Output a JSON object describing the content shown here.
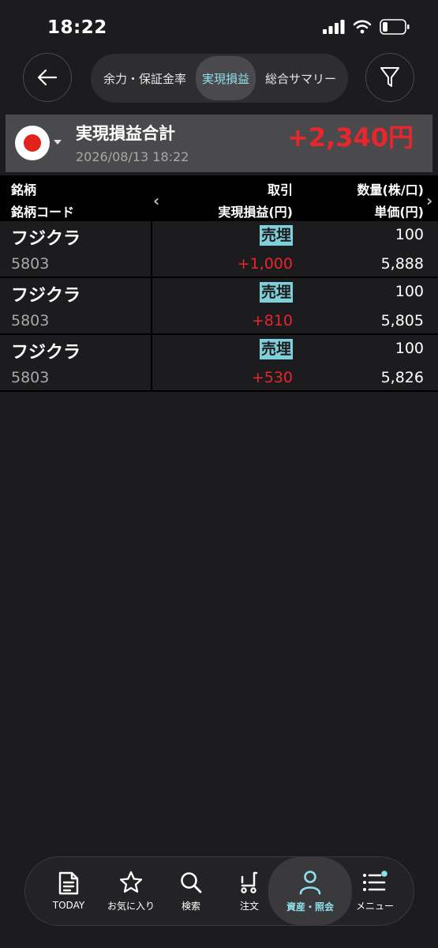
{
  "status": {
    "time": "18:22"
  },
  "tabs": [
    {
      "label": "余力・保証金率"
    },
    {
      "label": "実現損益"
    },
    {
      "label": "総合サマリー"
    }
  ],
  "summary": {
    "title": "実現損益合計",
    "date": "2026/08/13 18:22",
    "total": "+2,340円"
  },
  "table": {
    "headers": {
      "name": "銘柄",
      "code": "銘柄コード",
      "trade": "取引",
      "pl": "実現損益(円)",
      "qty": "数量(株/口)",
      "price": "単価(円)"
    },
    "rows": [
      {
        "name": "フジクラ",
        "code": "5803",
        "side": "売埋",
        "pl": "+1,000",
        "qty": "100",
        "price": "5,888"
      },
      {
        "name": "フジクラ",
        "code": "5803",
        "side": "売埋",
        "pl": "+810",
        "qty": "100",
        "price": "5,805"
      },
      {
        "name": "フジクラ",
        "code": "5803",
        "side": "売埋",
        "pl": "+530",
        "qty": "100",
        "price": "5,826"
      }
    ]
  },
  "nav": [
    {
      "label": "TODAY",
      "icon": "document-icon"
    },
    {
      "label": "お気に入り",
      "icon": "star-icon"
    },
    {
      "label": "検索",
      "icon": "search-icon"
    },
    {
      "label": "注文",
      "icon": "cart-icon"
    },
    {
      "label": "資産・照会",
      "icon": "person-icon"
    },
    {
      "label": "メニュー",
      "icon": "menu-icon"
    }
  ],
  "colors": {
    "accent": "#8fe0ea",
    "profit": "#e8262b",
    "sell_badge": "#7fd0d8"
  }
}
